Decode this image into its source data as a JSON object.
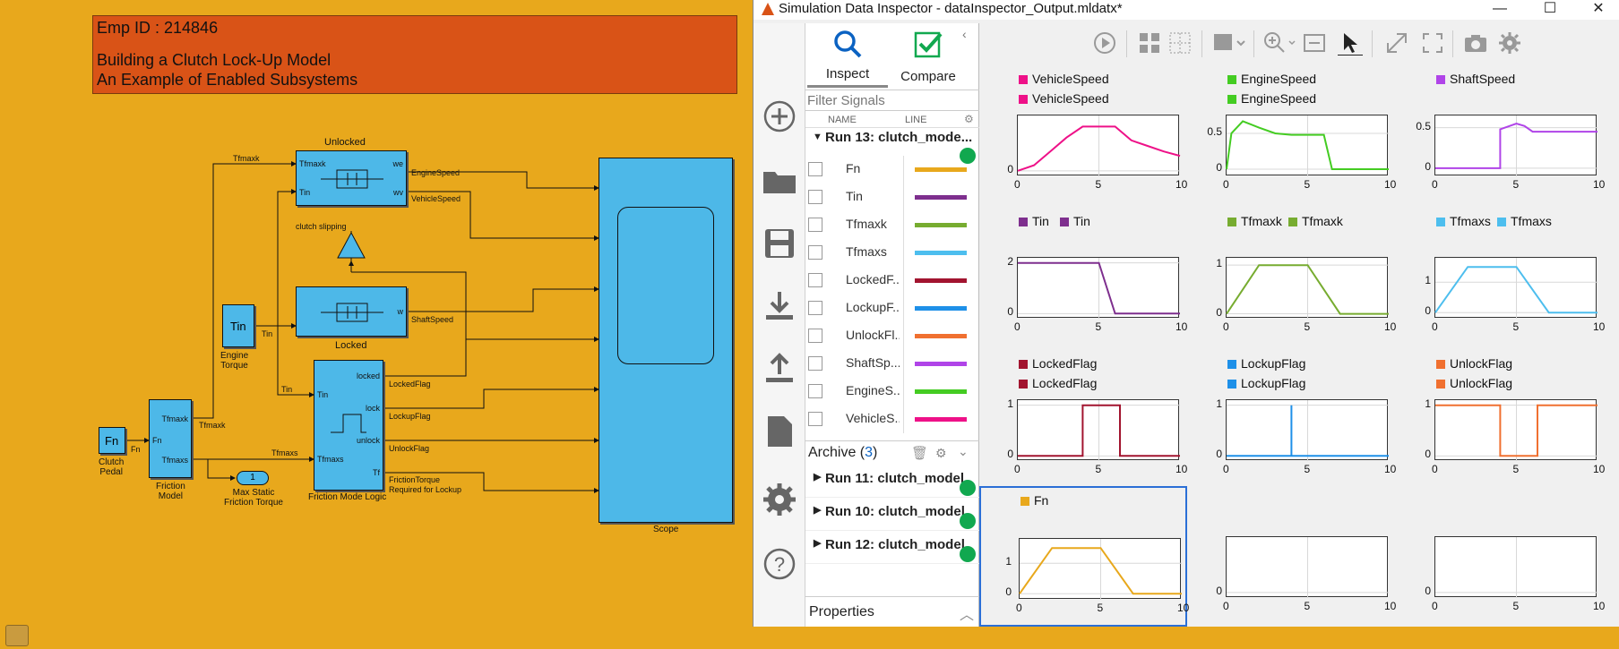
{
  "annotation": {
    "line1": "Emp ID : 214846",
    "line2": "Building a Clutch Lock-Up Model",
    "line3": "An Example of Enabled Subsystems"
  },
  "model": {
    "blocks": {
      "unlocked": "Unlocked",
      "locked": "Locked",
      "scope": "Scope",
      "engine_torque": "Engine\nTorque",
      "engine_torque_text": "Tin",
      "clutch_pedal": "Clutch\nPedal",
      "clutch_pedal_text": "Fn",
      "friction_model": "Friction\nModel",
      "friction_mode_logic": "Friction Mode Logic",
      "max_static": "Max Static\nFriction Torque",
      "max_static_value": "1",
      "clutch_slipping": "clutch slipping"
    },
    "ports": {
      "unlocked_in": [
        "Tfmaxk",
        "Tin"
      ],
      "unlocked_out": [
        "we",
        "wv"
      ],
      "locked_out": "w",
      "friction_in": "Fn",
      "friction_out": [
        "Tfmaxk",
        "Tfmaxs"
      ],
      "logic_in": [
        "Tin",
        "Tfmaxs"
      ],
      "logic_out": [
        "locked",
        "lock",
        "unlock",
        "Tf"
      ]
    },
    "signals": {
      "tfmaxk": "Tfmaxk",
      "tfmaxk_out": "Tfmaxk",
      "tin": "Tin",
      "tin_logic": "Tin",
      "fn": "Fn",
      "tfmaxs": "Tfmaxs",
      "engine_speed": "EngineSpeed",
      "vehicle_speed": "VehicleSpeed",
      "shaft_speed": "ShaftSpeed",
      "locked_flag": "LockedFlag",
      "lockup_flag": "LockupFlag",
      "unlock_flag": "UnlockFlag",
      "friction_torque": "FrictionTorque\nRequired for Lockup"
    }
  },
  "sdi": {
    "title": "Simulation Data Inspector - dataInspector_Output.mldatx*",
    "window_buttons": [
      "—",
      "☐",
      "✕"
    ],
    "tabs": {
      "inspect": "Inspect",
      "compare": "Compare"
    },
    "filter_placeholder": "Filter Signals",
    "columns": {
      "name": "NAME",
      "line": "LINE"
    },
    "current_run": "Run 13: clutch_mode...",
    "signals": [
      {
        "name": "Fn",
        "color": "#e8a81c"
      },
      {
        "name": "Tin",
        "color": "#7e2f8e"
      },
      {
        "name": "Tfmaxk",
        "color": "#77ac30"
      },
      {
        "name": "Tfmaxs",
        "color": "#4dbeee"
      },
      {
        "name": "LockedF...",
        "color": "#a2142f"
      },
      {
        "name": "LockupF...",
        "color": "#1e90e8"
      },
      {
        "name": "UnlockFl...",
        "color": "#f07030"
      },
      {
        "name": "ShaftSp...",
        "color": "#b044e8"
      },
      {
        "name": "EngineS...",
        "color": "#44cc22"
      },
      {
        "name": "VehicleS...",
        "color": "#ee1188"
      }
    ],
    "archive_label": "Archive (",
    "archive_count": "3",
    "archive_close": ")",
    "archive_runs": [
      "Run 11: clutch_model",
      "Run 10: clutch_model",
      "Run 12: clutch_model"
    ],
    "properties_label": "Properties",
    "status_color": "#11a84f",
    "plots": [
      {
        "legend": [
          [
            "VehicleSpeed",
            "#ee1188"
          ],
          [
            "VehicleSpeed",
            "#ee1188"
          ]
        ],
        "yticks": [
          "0"
        ],
        "xticks": [
          "0",
          "5",
          "10"
        ]
      },
      {
        "legend": [
          [
            "EngineSpeed",
            "#44cc22"
          ],
          [
            "EngineSpeed",
            "#44cc22"
          ]
        ],
        "yticks": [
          "0.5",
          "0"
        ],
        "xticks": [
          "0",
          "5",
          "10"
        ]
      },
      {
        "legend": [
          [
            "ShaftSpeed",
            "#b044e8"
          ]
        ],
        "yticks": [
          "0.5",
          "0"
        ],
        "xticks": [
          "0",
          "5",
          "10"
        ]
      },
      {
        "legend": [
          [
            "Tin",
            "#7e2f8e"
          ],
          [
            "Tin",
            "#7e2f8e"
          ]
        ],
        "yticks": [
          "2",
          "0"
        ],
        "xticks": [
          "0",
          "5",
          "10"
        ]
      },
      {
        "legend": [
          [
            "Tfmaxk",
            "#77ac30"
          ],
          [
            "Tfmaxk",
            "#77ac30"
          ]
        ],
        "yticks": [
          "1",
          "0"
        ],
        "xticks": [
          "0",
          "5",
          "10"
        ]
      },
      {
        "legend": [
          [
            "Tfmaxs",
            "#4dbeee"
          ],
          [
            "Tfmaxs",
            "#4dbeee"
          ]
        ],
        "yticks": [
          "1",
          "0"
        ],
        "xticks": [
          "0",
          "5",
          "10"
        ]
      },
      {
        "legend": [
          [
            "LockedFlag",
            "#a2142f"
          ],
          [
            "LockedFlag",
            "#a2142f"
          ]
        ],
        "yticks": [
          "1",
          "0"
        ],
        "xticks": [
          "0",
          "5",
          "10"
        ]
      },
      {
        "legend": [
          [
            "LockupFlag",
            "#1e90e8"
          ],
          [
            "LockupFlag",
            "#1e90e8"
          ]
        ],
        "yticks": [
          "1",
          "0"
        ],
        "xticks": [
          "0",
          "5",
          "10"
        ]
      },
      {
        "legend": [
          [
            "UnlockFlag",
            "#f07030"
          ],
          [
            "UnlockFlag",
            "#f07030"
          ]
        ],
        "yticks": [
          "1",
          "0"
        ],
        "xticks": [
          "0",
          "5",
          "10"
        ]
      },
      {
        "legend": [
          [
            "Fn",
            "#e8a81c"
          ]
        ],
        "yticks": [
          "1",
          "0"
        ],
        "xticks": [
          "0",
          "5",
          "10"
        ]
      },
      {
        "legend": [],
        "yticks": [
          "0"
        ],
        "xticks": [
          "0",
          "5",
          "10"
        ]
      },
      {
        "legend": [],
        "yticks": [
          "0"
        ],
        "xticks": [
          "0",
          "5",
          "10"
        ]
      }
    ]
  },
  "chart_data": [
    {
      "type": "line",
      "series": [
        {
          "name": "VehicleSpeed",
          "x": [
            0,
            1,
            2,
            3,
            4,
            5,
            6,
            7,
            8,
            9,
            10
          ],
          "y": [
            0,
            0.1,
            0.35,
            0.6,
            0.8,
            0.8,
            0.8,
            0.55,
            0.45,
            0.35,
            0.27
          ]
        }
      ],
      "xlim": [
        0,
        10
      ]
    },
    {
      "type": "line",
      "series": [
        {
          "name": "EngineSpeed",
          "x": [
            0,
            0.3,
            1,
            2,
            3,
            4,
            5,
            6,
            6.5,
            10
          ],
          "y": [
            0,
            0.5,
            0.67,
            0.58,
            0.5,
            0.48,
            0.48,
            0.48,
            0,
            0
          ]
        }
      ],
      "xlim": [
        0,
        10
      ]
    },
    {
      "type": "line",
      "series": [
        {
          "name": "ShaftSpeed",
          "x": [
            0,
            4,
            4,
            5,
            5.5,
            6,
            10
          ],
          "y": [
            0,
            0,
            0.48,
            0.55,
            0.52,
            0.45,
            0.45
          ]
        }
      ],
      "xlim": [
        0,
        10
      ]
    },
    {
      "type": "line",
      "series": [
        {
          "name": "Tin",
          "x": [
            0,
            5,
            6,
            10
          ],
          "y": [
            2,
            2,
            0,
            0
          ]
        }
      ],
      "xlim": [
        0,
        10
      ]
    },
    {
      "type": "line",
      "series": [
        {
          "name": "Tfmaxk",
          "x": [
            0,
            2,
            5,
            7,
            10
          ],
          "y": [
            0,
            1,
            1,
            0,
            0
          ]
        }
      ],
      "xlim": [
        0,
        10
      ]
    },
    {
      "type": "line",
      "series": [
        {
          "name": "Tfmaxs",
          "x": [
            0,
            2,
            5,
            7,
            10
          ],
          "y": [
            0,
            1.5,
            1.5,
            0,
            0
          ]
        }
      ],
      "xlim": [
        0,
        10
      ]
    },
    {
      "type": "line",
      "series": [
        {
          "name": "LockedFlag",
          "x": [
            0,
            4,
            4,
            6.3,
            6.3,
            10
          ],
          "y": [
            0,
            0,
            1,
            1,
            0,
            0
          ]
        }
      ],
      "xlim": [
        0,
        10
      ]
    },
    {
      "type": "line",
      "series": [
        {
          "name": "LockupFlag",
          "x": [
            0,
            4,
            4,
            4,
            10
          ],
          "y": [
            0,
            0,
            1,
            0,
            0
          ]
        }
      ],
      "xlim": [
        0,
        10
      ]
    },
    {
      "type": "line",
      "series": [
        {
          "name": "UnlockFlag",
          "x": [
            0,
            4,
            4,
            6.3,
            6.3,
            10
          ],
          "y": [
            1,
            1,
            0,
            0,
            1,
            1
          ]
        }
      ],
      "xlim": [
        0,
        10
      ]
    },
    {
      "type": "line",
      "series": [
        {
          "name": "Fn",
          "x": [
            0,
            2,
            5,
            7,
            10
          ],
          "y": [
            0,
            1.5,
            1.5,
            0,
            0
          ]
        }
      ],
      "xlim": [
        0,
        10
      ]
    }
  ]
}
